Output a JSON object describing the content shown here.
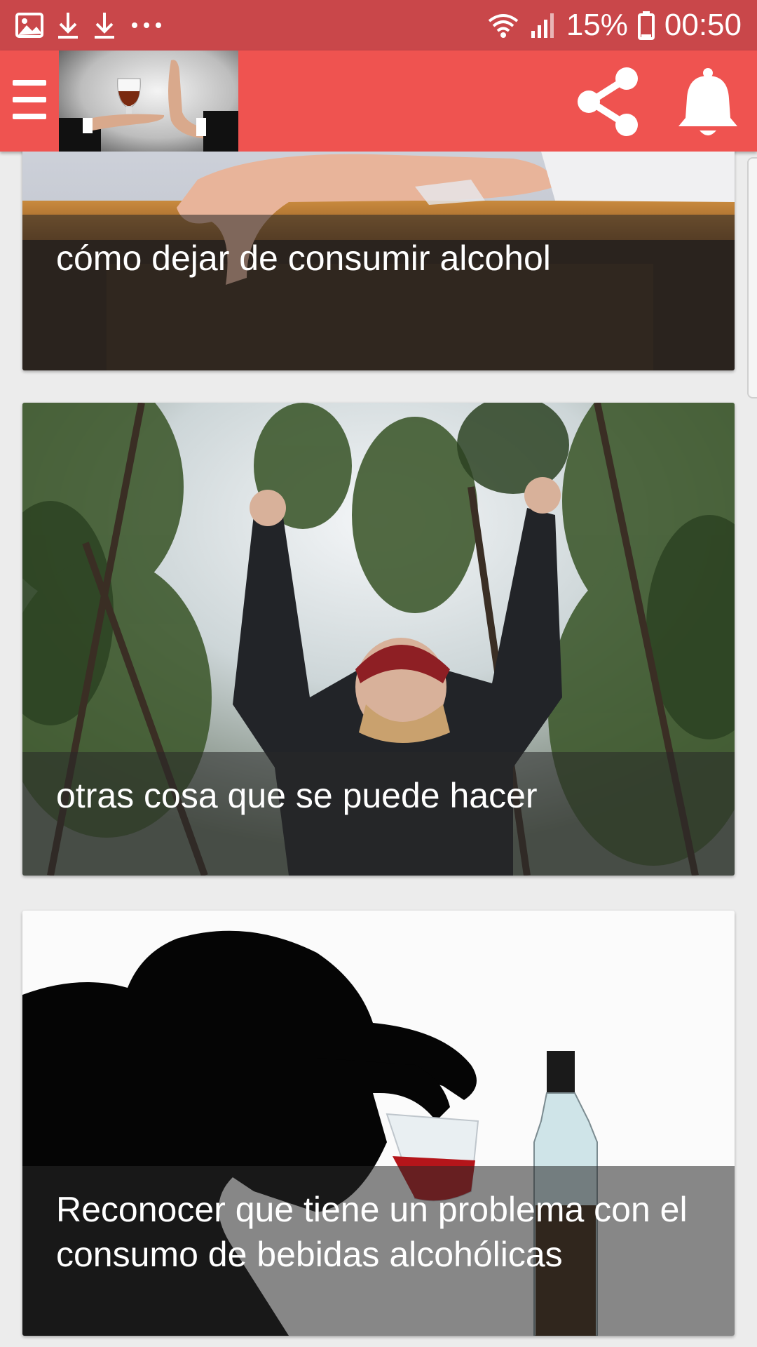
{
  "status_bar": {
    "battery": "15%",
    "time": "00:50",
    "notification_icons": [
      "image-icon",
      "download-icon",
      "download-icon",
      "more-dots-icon"
    ]
  },
  "app_bar": {
    "color": "#ef5350",
    "status_color": "#c9474a",
    "icons": [
      "menu-icon",
      "share-icon",
      "bell-icon"
    ]
  },
  "articles": [
    {
      "title": "cómo dejar de consumir alcohol"
    },
    {
      "title": "otras cosa que se puede hacer"
    },
    {
      "title": "Reconocer que tiene un problema con el consumo de bebidas alcohólicas"
    }
  ]
}
